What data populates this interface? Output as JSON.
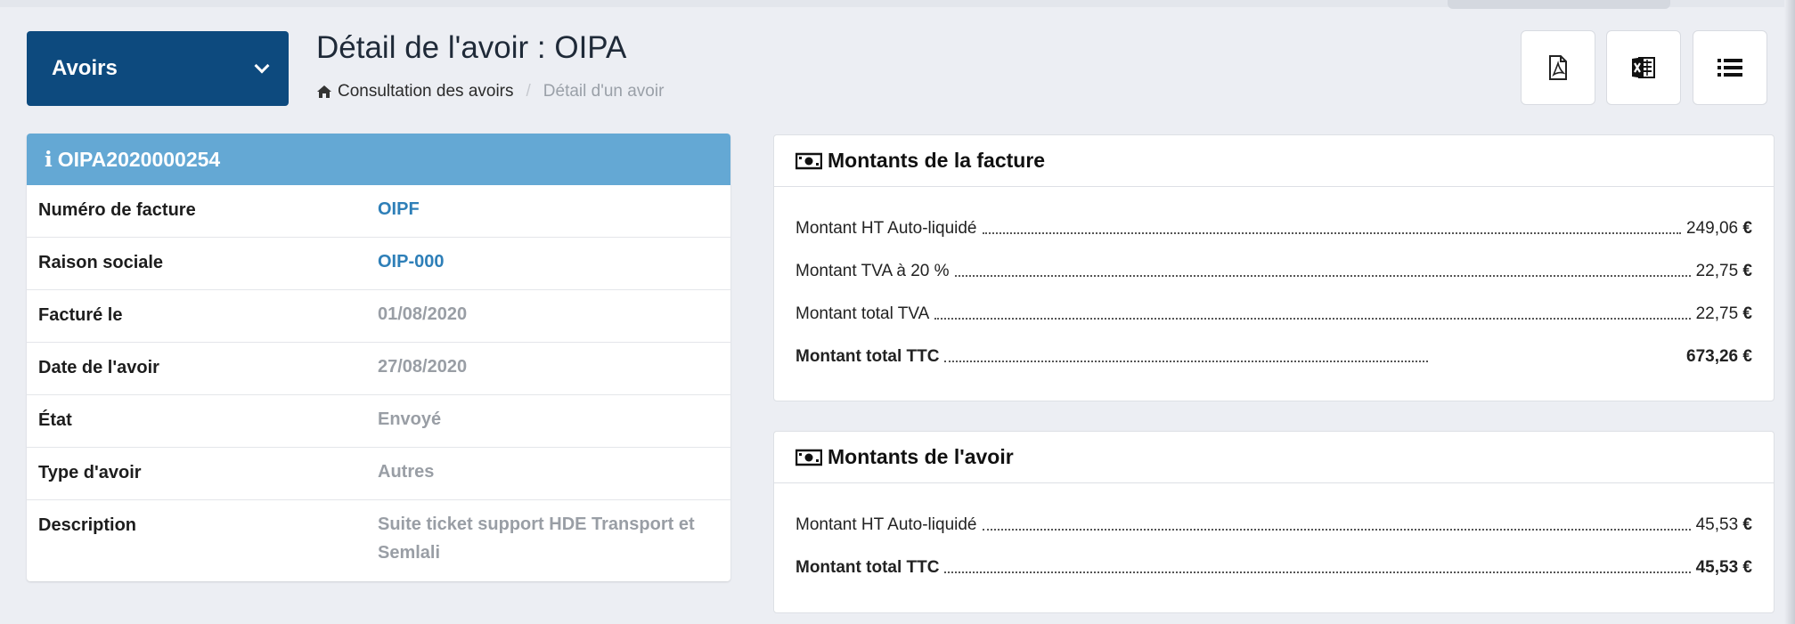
{
  "section_selector": {
    "label": "Avoirs"
  },
  "page": {
    "title": "Détail de l'avoir : OIPA",
    "breadcrumb": {
      "link": "Consultation des avoirs",
      "current": "Détail d'un avoir"
    }
  },
  "toolbar": {
    "buttons": [
      {
        "name": "pdf-export",
        "icon": "file-pdf-icon"
      },
      {
        "name": "excel-export",
        "icon": "file-excel-icon"
      },
      {
        "name": "list-view",
        "icon": "list-icon"
      }
    ]
  },
  "info": {
    "header": "OIPA2020000254",
    "rows": [
      {
        "key": "Numéro de facture",
        "value": "OIPF"
      },
      {
        "key": "Raison sociale",
        "value": "OIP-000"
      },
      {
        "key": "Facturé le",
        "value": "01/08/2020"
      },
      {
        "key": "Date de l'avoir",
        "value": "27/08/2020"
      },
      {
        "key": "État",
        "value": "Envoyé"
      },
      {
        "key": "Type d'avoir",
        "value": "Autres"
      },
      {
        "key": "Description",
        "value": "Suite ticket support HDE Transport et Semlali"
      }
    ]
  },
  "invoice_amounts": {
    "title": "Montants de la facture",
    "rows": [
      {
        "label": "Montant HT Auto-liquidé",
        "value": "249,06"
      },
      {
        "label": "Montant TVA à 20 %",
        "value": "22,75"
      },
      {
        "label": "Montant total TVA",
        "value": "22,75"
      },
      {
        "label": "Montant total TTC",
        "value": "673,26"
      }
    ],
    "currency": "€"
  },
  "credit_amounts": {
    "title": "Montants de l'avoir",
    "rows": [
      {
        "label": "Montant HT Auto-liquidé",
        "value": "45,53"
      },
      {
        "label": "Montant total TTC",
        "value": "45,53"
      }
    ],
    "currency": "€"
  },
  "colors": {
    "dropdown_bg": "#0d4a7e",
    "info_header_bg": "#64a8d4",
    "link": "#2e7fb8",
    "muted": "#999ea5",
    "page_bg": "#eceef3"
  }
}
